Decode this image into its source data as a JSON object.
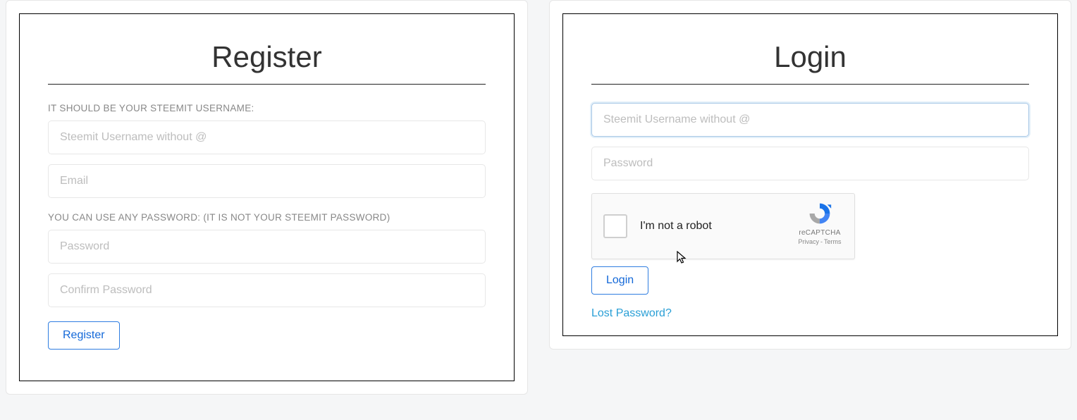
{
  "register": {
    "title": "Register",
    "username_label": "IT SHOULD BE YOUR STEEMIT USERNAME:",
    "username_placeholder": "Steemit Username without @",
    "email_placeholder": "Email",
    "password_label": "YOU CAN USE ANY PASSWORD: (IT IS NOT YOUR STEEMIT PASSWORD)",
    "password_placeholder": "Password",
    "confirm_placeholder": "Confirm Password",
    "button": "Register"
  },
  "login": {
    "title": "Login",
    "username_placeholder": "Steemit Username without @",
    "password_placeholder": "Password",
    "button": "Login",
    "lost": "Lost Password?"
  },
  "recaptcha": {
    "label": "I'm not a robot",
    "brand": "reCAPTCHA",
    "privacy": "Privacy",
    "terms": "Terms"
  }
}
